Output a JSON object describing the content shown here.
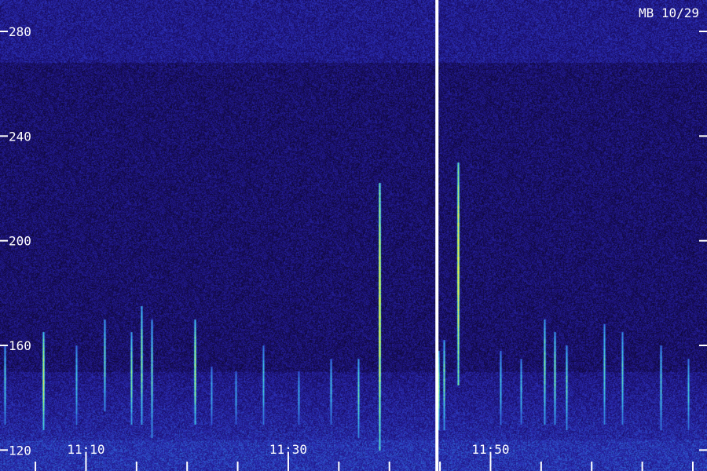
{
  "chart_data": {
    "type": "heatmap",
    "title": "MB 10/29",
    "xlabel": "",
    "ylabel": "",
    "ylim": [
      112,
      292
    ],
    "xlim_minutes": [
      1.5,
      71.4
    ],
    "y_ticks": [
      120,
      160,
      200,
      240,
      280
    ],
    "x_tick_labels": [
      {
        "minute": 10,
        "label": "11:10"
      },
      {
        "minute": 30,
        "label": "11:30"
      },
      {
        "minute": 50,
        "label": "11:50"
      }
    ],
    "x_minor_tick_minutes": [
      5,
      10,
      15,
      20,
      25,
      30,
      35,
      40,
      45,
      50,
      55,
      60,
      65,
      70
    ],
    "data_gap_minute": 44.7,
    "grid": false,
    "colormap": [
      "#0c0626",
      "#1a0f6e",
      "#2a2ab0",
      "#2f6fd8",
      "#3fd0e0",
      "#9cff6a",
      "#ffe040"
    ],
    "echoes": [
      {
        "minute": 39.0,
        "y_from": 120,
        "y_to": 222,
        "intensity": 0.95
      },
      {
        "minute": 46.8,
        "y_from": 145,
        "y_to": 230,
        "intensity": 0.95
      },
      {
        "minute": 5.8,
        "y_from": 128,
        "y_to": 165,
        "intensity": 0.75
      },
      {
        "minute": 20.8,
        "y_from": 130,
        "y_to": 170,
        "intensity": 0.7
      },
      {
        "minute": 15.5,
        "y_from": 130,
        "y_to": 175,
        "intensity": 0.6
      },
      {
        "minute": 11.8,
        "y_from": 135,
        "y_to": 170,
        "intensity": 0.5
      },
      {
        "minute": 14.5,
        "y_from": 130,
        "y_to": 165,
        "intensity": 0.55
      },
      {
        "minute": 16.5,
        "y_from": 125,
        "y_to": 170,
        "intensity": 0.5
      },
      {
        "minute": 44.8,
        "y_from": 128,
        "y_to": 158,
        "intensity": 0.6
      },
      {
        "minute": 45.4,
        "y_from": 128,
        "y_to": 162,
        "intensity": 0.55
      },
      {
        "minute": 55.3,
        "y_from": 130,
        "y_to": 170,
        "intensity": 0.55
      },
      {
        "minute": 56.3,
        "y_from": 130,
        "y_to": 165,
        "intensity": 0.55
      },
      {
        "minute": 57.5,
        "y_from": 128,
        "y_to": 160,
        "intensity": 0.5
      },
      {
        "minute": 2.0,
        "y_from": 130,
        "y_to": 160,
        "intensity": 0.45
      },
      {
        "minute": 9.0,
        "y_from": 130,
        "y_to": 160,
        "intensity": 0.4
      },
      {
        "minute": 36.9,
        "y_from": 125,
        "y_to": 155,
        "intensity": 0.5
      },
      {
        "minute": 27.5,
        "y_from": 130,
        "y_to": 160,
        "intensity": 0.4
      },
      {
        "minute": 34.2,
        "y_from": 130,
        "y_to": 155,
        "intensity": 0.4
      },
      {
        "minute": 61.2,
        "y_from": 130,
        "y_to": 168,
        "intensity": 0.45
      },
      {
        "minute": 63.0,
        "y_from": 130,
        "y_to": 165,
        "intensity": 0.45
      },
      {
        "minute": 66.8,
        "y_from": 128,
        "y_to": 160,
        "intensity": 0.45
      },
      {
        "minute": 22.4,
        "y_from": 130,
        "y_to": 152,
        "intensity": 0.35
      },
      {
        "minute": 24.8,
        "y_from": 130,
        "y_to": 150,
        "intensity": 0.35
      },
      {
        "minute": 31.0,
        "y_from": 130,
        "y_to": 150,
        "intensity": 0.35
      },
      {
        "minute": 51.0,
        "y_from": 130,
        "y_to": 158,
        "intensity": 0.4
      },
      {
        "minute": 53.0,
        "y_from": 130,
        "y_to": 155,
        "intensity": 0.4
      },
      {
        "minute": 69.5,
        "y_from": 128,
        "y_to": 155,
        "intensity": 0.4
      }
    ]
  }
}
